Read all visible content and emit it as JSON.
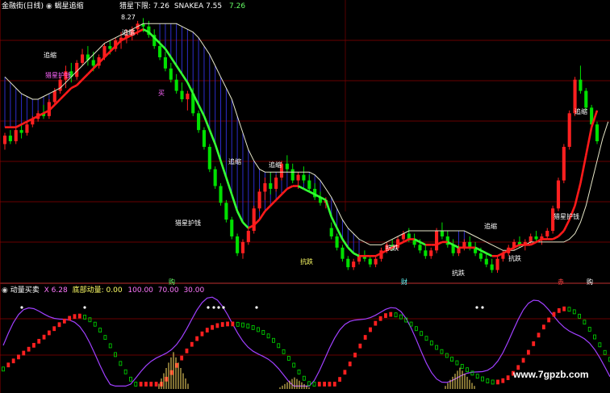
{
  "colors": {
    "background": "#000000",
    "grid": "#8b0000",
    "up": "#ff2020",
    "down": "#00e000",
    "green_line": "#33ff33",
    "red_line": "#ff1a1a",
    "white_line": "#e6e6c8",
    "blue_fill": "#2c2cc8",
    "purple_line": "#a040ff",
    "yellow_bars": "#ffe066",
    "text_white": "#ffffff",
    "text_yellow": "#ffff66",
    "text_cyan": "#66ffff",
    "text_pink": "#ff77ff",
    "text_green": "#66ff66"
  },
  "top_header": {
    "title": "金融街(日线)",
    "indicator": "蝎星追缩",
    "series_label": "猎星下限:",
    "series_value": "7.26",
    "snake_label": "SNAKEA",
    "snake_value": "7.55",
    "extra_value": "7.26",
    "price_tag": "8.27"
  },
  "bottom_header": {
    "indicator": "动量买卖",
    "x_label": "X",
    "x_value": "6.28",
    "momentum_label": "底部动量:",
    "momentum_value": "0.00",
    "levels": [
      "100.00",
      "70.00",
      "30.00"
    ]
  },
  "chart_labels": {
    "chase": "追缩",
    "guard": "猎星护钱",
    "defend": "抗跌",
    "buy": "买",
    "period": "购",
    "wealth": "财",
    "red": "赤",
    "watermark": "www.7gpzb.com"
  },
  "chart_data": {
    "type": "candlestick",
    "candles": [
      [
        8.0,
        8.2,
        7.9,
        8.15
      ],
      [
        8.15,
        8.25,
        8.0,
        8.05
      ],
      [
        8.05,
        8.3,
        8.0,
        8.25
      ],
      [
        8.25,
        8.35,
        8.1,
        8.2
      ],
      [
        8.2,
        8.4,
        8.15,
        8.35
      ],
      [
        8.35,
        8.5,
        8.3,
        8.45
      ],
      [
        8.45,
        8.6,
        8.4,
        8.55
      ],
      [
        8.55,
        8.7,
        8.45,
        8.5
      ],
      [
        8.5,
        8.8,
        8.45,
        8.75
      ],
      [
        8.75,
        9.0,
        8.7,
        8.95
      ],
      [
        8.95,
        9.2,
        8.9,
        9.15
      ],
      [
        9.15,
        9.4,
        9.0,
        9.3
      ],
      [
        9.3,
        9.45,
        9.1,
        9.2
      ],
      [
        9.2,
        9.5,
        9.15,
        9.45
      ],
      [
        9.45,
        9.7,
        9.4,
        9.6
      ],
      [
        9.6,
        9.75,
        9.4,
        9.5
      ],
      [
        9.5,
        9.65,
        9.3,
        9.4
      ],
      [
        9.4,
        9.6,
        9.35,
        9.55
      ],
      [
        9.55,
        9.8,
        9.5,
        9.75
      ],
      [
        9.75,
        9.85,
        9.6,
        9.7
      ],
      [
        9.7,
        9.9,
        9.65,
        9.85
      ],
      [
        9.85,
        10.0,
        9.7,
        9.9
      ],
      [
        9.9,
        10.05,
        9.8,
        9.95
      ],
      [
        9.95,
        10.1,
        9.85,
        10.05
      ],
      [
        10.05,
        10.2,
        9.95,
        10.15
      ],
      [
        10.15,
        10.25,
        10.0,
        10.1
      ],
      [
        10.1,
        10.2,
        9.9,
        9.95
      ],
      [
        9.95,
        10.05,
        9.7,
        9.75
      ],
      [
        9.75,
        9.85,
        9.5,
        9.55
      ],
      [
        9.55,
        9.65,
        9.3,
        9.35
      ],
      [
        9.35,
        9.45,
        9.1,
        9.15
      ],
      [
        9.15,
        9.25,
        8.9,
        8.95
      ],
      [
        8.95,
        9.1,
        8.75,
        8.8
      ],
      [
        8.8,
        8.95,
        8.6,
        8.9
      ],
      [
        8.9,
        9.0,
        8.5,
        8.55
      ],
      [
        8.55,
        8.6,
        8.2,
        8.25
      ],
      [
        8.25,
        8.3,
        7.9,
        7.95
      ],
      [
        7.95,
        8.0,
        7.5,
        7.55
      ],
      [
        7.55,
        7.6,
        7.2,
        7.25
      ],
      [
        7.25,
        7.3,
        6.9,
        6.95
      ],
      [
        6.95,
        7.0,
        6.6,
        6.65
      ],
      [
        6.65,
        6.7,
        6.3,
        6.35
      ],
      [
        6.35,
        6.4,
        6.0,
        6.05
      ],
      [
        6.05,
        6.3,
        5.95,
        6.25
      ],
      [
        6.25,
        6.5,
        6.2,
        6.45
      ],
      [
        6.45,
        6.9,
        6.4,
        6.85
      ],
      [
        6.85,
        7.2,
        6.8,
        7.15
      ],
      [
        7.15,
        7.4,
        7.0,
        7.3
      ],
      [
        7.3,
        7.5,
        7.1,
        7.2
      ],
      [
        7.2,
        7.45,
        7.15,
        7.4
      ],
      [
        7.4,
        7.7,
        7.35,
        7.65
      ],
      [
        7.65,
        7.8,
        7.5,
        7.55
      ],
      [
        7.55,
        7.65,
        7.3,
        7.35
      ],
      [
        7.35,
        7.5,
        7.2,
        7.45
      ],
      [
        7.45,
        7.6,
        7.3,
        7.35
      ],
      [
        7.35,
        7.45,
        7.15,
        7.2
      ],
      [
        7.2,
        7.3,
        7.0,
        7.05
      ],
      [
        7.05,
        7.15,
        6.9,
        6.95
      ],
      [
        6.95,
        7.05,
        6.85,
        7.0
      ],
      [
        6.5,
        6.6,
        6.3,
        6.35
      ],
      [
        6.35,
        6.4,
        6.1,
        6.15
      ],
      [
        6.15,
        6.2,
        5.9,
        5.95
      ],
      [
        5.95,
        6.0,
        5.75,
        5.8
      ],
      [
        5.8,
        5.95,
        5.75,
        5.9
      ],
      [
        5.9,
        6.05,
        5.85,
        6.0
      ],
      [
        6.0,
        6.1,
        5.9,
        5.95
      ],
      [
        5.95,
        6.0,
        5.8,
        5.85
      ],
      [
        5.85,
        6.0,
        5.8,
        5.95
      ],
      [
        5.95,
        6.15,
        5.9,
        6.1
      ],
      [
        6.1,
        6.25,
        6.05,
        6.2
      ],
      [
        6.2,
        6.3,
        6.1,
        6.15
      ],
      [
        6.15,
        6.35,
        6.1,
        6.3
      ],
      [
        6.3,
        6.45,
        6.25,
        6.4
      ],
      [
        6.4,
        6.5,
        6.25,
        6.3
      ],
      [
        6.3,
        6.4,
        6.15,
        6.2
      ],
      [
        6.2,
        6.3,
        6.05,
        6.1
      ],
      [
        6.1,
        6.2,
        5.95,
        6.0
      ],
      [
        6.0,
        6.15,
        5.95,
        6.1
      ],
      [
        6.1,
        6.5,
        6.05,
        6.45
      ],
      [
        6.45,
        6.6,
        6.3,
        6.35
      ],
      [
        6.35,
        6.45,
        6.15,
        6.2
      ],
      [
        6.2,
        6.3,
        6.0,
        6.05
      ],
      [
        6.05,
        6.2,
        6.0,
        6.15
      ],
      [
        6.15,
        6.3,
        6.1,
        6.25
      ],
      [
        6.25,
        6.35,
        6.1,
        6.15
      ],
      [
        6.15,
        6.25,
        6.0,
        6.05
      ],
      [
        6.05,
        6.15,
        5.9,
        5.95
      ],
      [
        5.95,
        6.05,
        5.8,
        5.85
      ],
      [
        5.85,
        5.95,
        5.7,
        5.75
      ],
      [
        5.75,
        6.0,
        5.7,
        5.95
      ],
      [
        5.95,
        6.1,
        5.9,
        6.05
      ],
      [
        6.05,
        6.2,
        6.0,
        6.15
      ],
      [
        6.15,
        6.3,
        6.1,
        6.25
      ],
      [
        6.25,
        6.35,
        6.15,
        6.2
      ],
      [
        6.2,
        6.3,
        6.1,
        6.25
      ],
      [
        6.25,
        6.4,
        6.2,
        6.35
      ],
      [
        6.35,
        6.45,
        6.25,
        6.3
      ],
      [
        6.3,
        6.4,
        6.2,
        6.35
      ],
      [
        6.35,
        6.5,
        6.3,
        6.45
      ],
      [
        6.45,
        6.9,
        6.4,
        6.85
      ],
      [
        6.85,
        7.4,
        6.8,
        7.35
      ],
      [
        7.35,
        8.0,
        7.3,
        7.95
      ],
      [
        7.95,
        8.6,
        7.9,
        8.55
      ],
      [
        8.55,
        9.2,
        8.5,
        9.15
      ],
      [
        9.15,
        9.4,
        8.9,
        8.95
      ],
      [
        8.95,
        9.0,
        8.6,
        8.65
      ],
      [
        8.65,
        8.7,
        8.3,
        8.35
      ],
      [
        8.35,
        8.4,
        8.0,
        8.05
      ]
    ],
    "green_line": [
      8.3,
      8.3,
      8.3,
      8.35,
      8.4,
      8.45,
      8.5,
      8.55,
      8.6,
      8.7,
      8.8,
      8.9,
      9.0,
      9.05,
      9.15,
      9.25,
      9.35,
      9.45,
      9.55,
      9.65,
      9.75,
      9.85,
      9.9,
      9.95,
      10.0,
      10.05,
      10.0,
      9.9,
      9.8,
      9.7,
      9.55,
      9.4,
      9.25,
      9.1,
      8.9,
      8.7,
      8.5,
      8.25,
      8.0,
      7.7,
      7.4,
      7.1,
      6.8,
      6.6,
      6.5,
      6.55,
      6.65,
      6.8,
      6.9,
      7.0,
      7.1,
      7.2,
      7.25,
      7.25,
      7.2,
      7.15,
      7.1,
      7.05,
      7.0,
      6.7,
      6.5,
      6.3,
      6.15,
      6.05,
      6.0,
      6.0,
      6.0,
      6.0,
      6.05,
      6.1,
      6.15,
      6.2,
      6.25,
      6.3,
      6.3,
      6.25,
      6.2,
      6.2,
      6.2,
      6.25,
      6.25,
      6.2,
      6.15,
      6.15,
      6.15,
      6.15,
      6.1,
      6.05,
      6.0,
      6.0,
      6.05,
      6.1,
      6.15,
      6.2,
      6.2,
      6.2,
      6.25,
      6.3,
      6.3,
      6.3,
      6.35,
      6.45,
      6.65,
      6.9,
      7.3,
      7.8,
      8.3,
      8.6,
      8.6,
      8.5
    ],
    "white_line": [
      9.2,
      9.1,
      9.0,
      8.9,
      8.85,
      8.8,
      8.8,
      8.85,
      8.9,
      8.95,
      9.0,
      9.1,
      9.2,
      9.3,
      9.4,
      9.5,
      9.6,
      9.7,
      9.8,
      9.85,
      9.9,
      9.95,
      10.0,
      10.05,
      10.1,
      10.15,
      10.15,
      10.15,
      10.15,
      10.15,
      10.15,
      10.15,
      10.1,
      10.05,
      10.0,
      9.9,
      9.75,
      9.6,
      9.4,
      9.2,
      9.0,
      8.8,
      8.5,
      8.2,
      7.9,
      7.7,
      7.55,
      7.5,
      7.5,
      7.5,
      7.5,
      7.5,
      7.5,
      7.5,
      7.5,
      7.5,
      7.45,
      7.35,
      7.2,
      7.05,
      6.85,
      6.65,
      6.5,
      6.4,
      6.3,
      6.25,
      6.2,
      6.2,
      6.2,
      6.25,
      6.3,
      6.35,
      6.4,
      6.45,
      6.45,
      6.45,
      6.45,
      6.45,
      6.45,
      6.45,
      6.45,
      6.45,
      6.45,
      6.45,
      6.4,
      6.35,
      6.3,
      6.25,
      6.2,
      6.15,
      6.1,
      6.1,
      6.1,
      6.15,
      6.2,
      6.25,
      6.25,
      6.25,
      6.25,
      6.25,
      6.25,
      6.25,
      6.3,
      6.4,
      6.6,
      6.9,
      7.3,
      7.7,
      8.1,
      8.4
    ]
  }
}
